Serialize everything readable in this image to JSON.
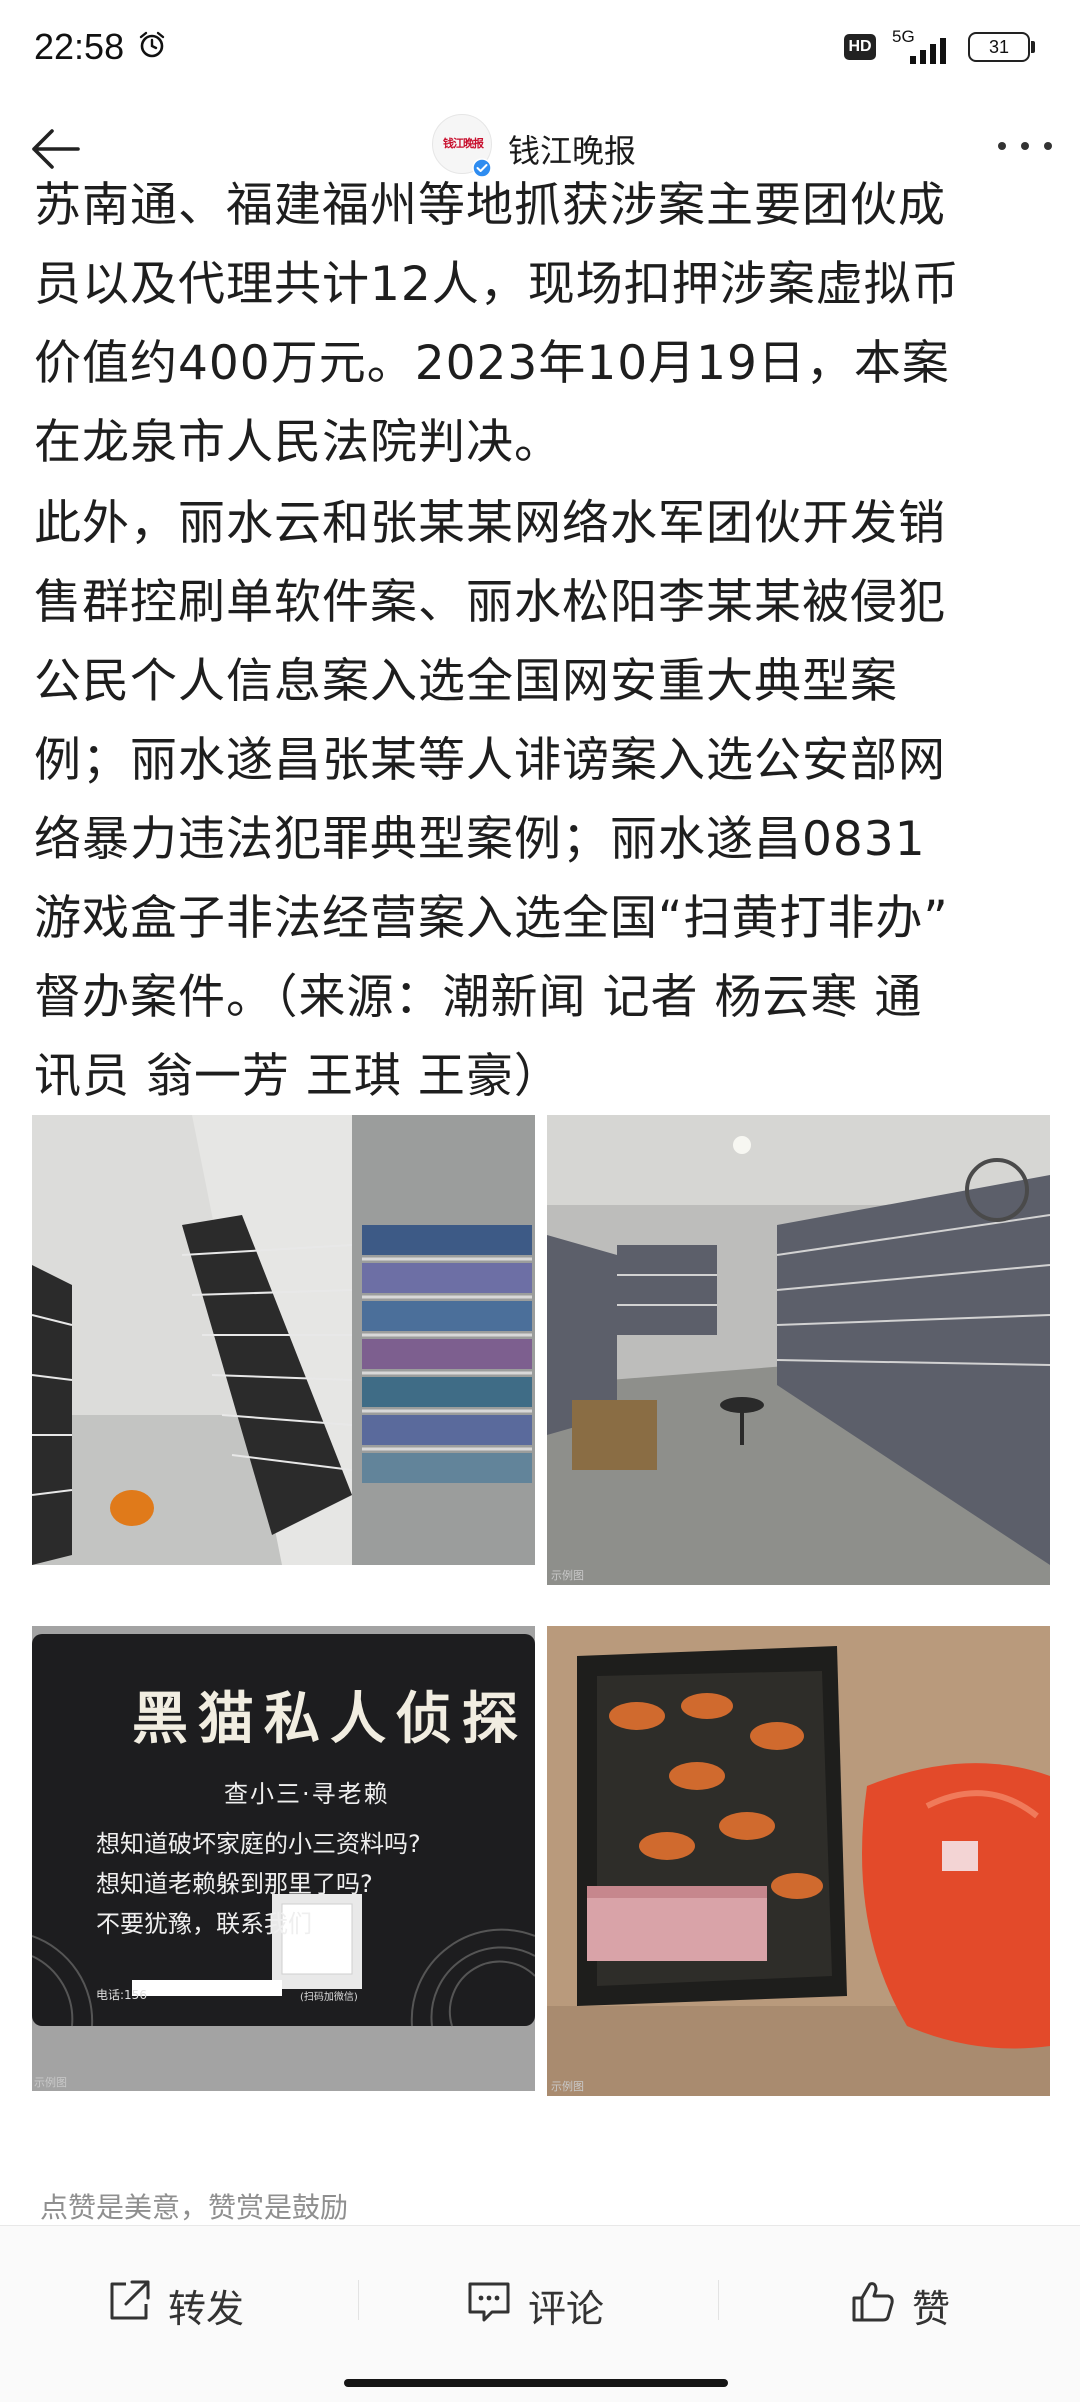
{
  "status_bar": {
    "time": "22:58",
    "network": "5G",
    "battery": "31",
    "hd_badge": "HD"
  },
  "header": {
    "channel_name": "钱江晚报",
    "avatar_text": "钱江晚报"
  },
  "article": {
    "paragraph_1": "苏南通、福建福州等地抓获涉案主要团伙成\n员以及代理共计12人，现场扣押涉案虚拟币\n价值约400万元。2023年10月19日，本案\n在龙泉市人民法院判决。",
    "paragraph_2": "此外，丽水云和张某某网络水军团伙开发销\n售群控刷单软件案、丽水松阳李某某被侵犯\n公民个人信息案入选全国网安重大典型案\n例；丽水遂昌张某等人诽谤案入选公安部网\n络暴力违法犯罪典型案例；丽水遂昌0831\n游戏盒子非法经营案入选全国“扫黄打非办”\n督办案件。（来源：潮新闻 记者 杨云寒 通\n讯员 翁一芳 王琪 王豪）"
  },
  "images": {
    "card": {
      "title": "黑猫私人侦探",
      "subtitle": "查小三·寻老赖",
      "line_1": "想知道破坏家庭的小三资料吗?",
      "line_2": "想知道老赖躲到那里了吗?",
      "line_3": "不要犹豫，联系我们",
      "phone": "电话:156",
      "qr_label": "(扫码加微信)"
    },
    "watermark_left": "示例图",
    "watermark_right": "示例图"
  },
  "footer": {
    "reward_hint": "点赞是美意，赞赏是鼓励"
  },
  "actions": {
    "share": "转发",
    "comment": "评论",
    "like": "赞"
  },
  "icons": [
    "alarm-icon",
    "signal-icon",
    "back-arrow-icon",
    "verified-icon",
    "more-icon",
    "share-icon",
    "comment-icon",
    "like-icon"
  ],
  "colors": {
    "brand_red": "#c8102e",
    "verified_blue": "#2e8cf0",
    "text": "#1e1e1e",
    "hint": "#8f8f8f"
  }
}
